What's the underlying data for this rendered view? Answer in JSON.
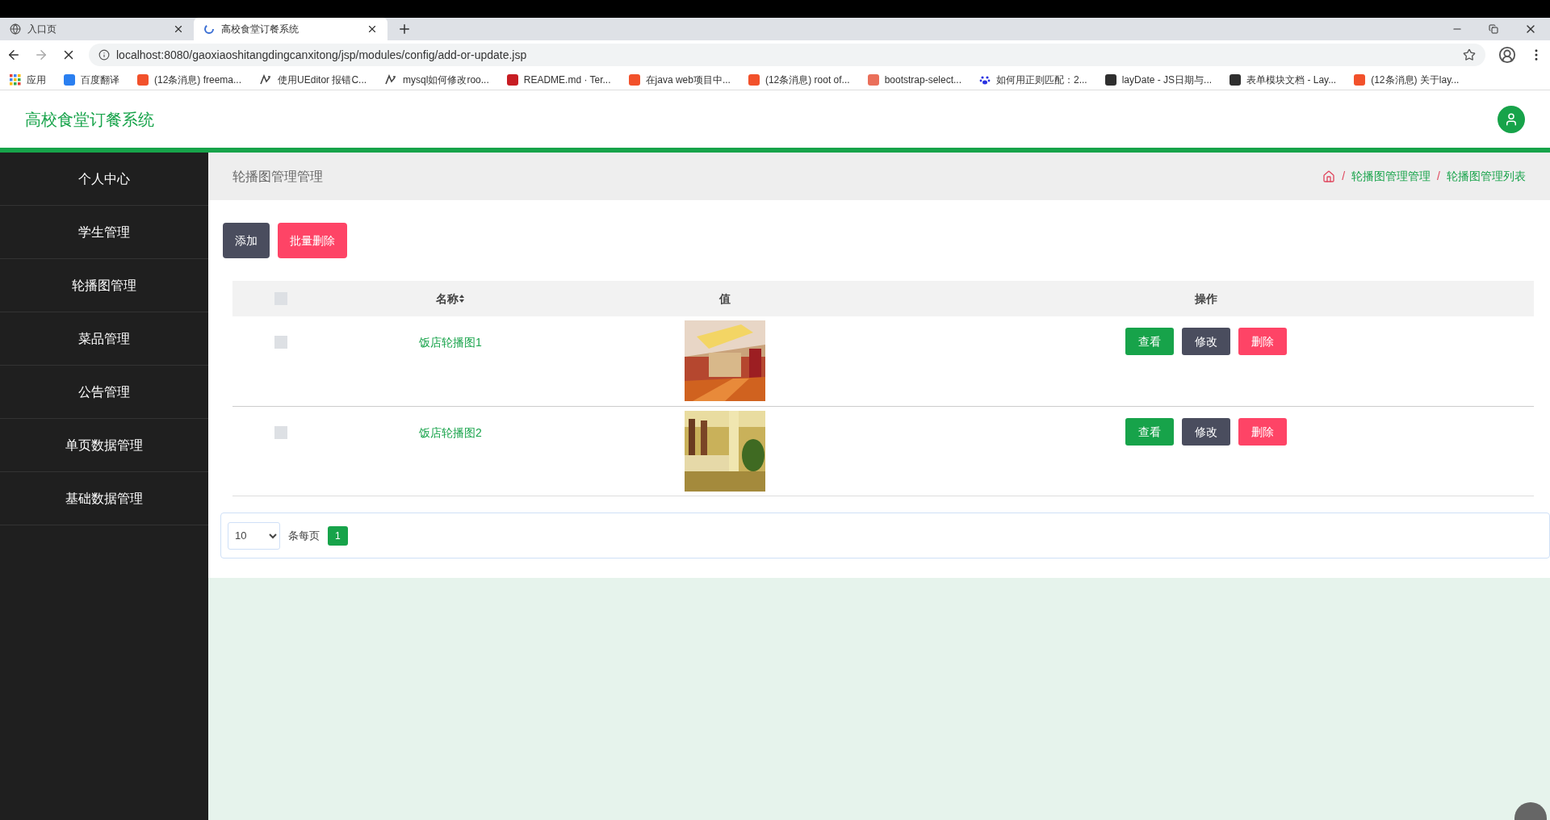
{
  "browser": {
    "tabs": [
      {
        "title": "入口页",
        "selected": false,
        "kind": "globe"
      },
      {
        "title": "高校食堂订餐系统",
        "selected": true,
        "kind": "loading"
      }
    ],
    "url": "localhost:8080/gaoxiaoshitangdingcanxitong/jsp/modules/config/add-or-update.jsp",
    "bookmarks": [
      {
        "label": "应用",
        "kind": "apps"
      },
      {
        "label": "百度翻译",
        "kind": "site",
        "color": "#2a7ff0"
      },
      {
        "label": "(12条消息) freema...",
        "kind": "site",
        "color": "#f2512b"
      },
      {
        "label": "使用UEditor 报错C...",
        "kind": "glyph"
      },
      {
        "label": "mysql如何修改roo...",
        "kind": "glyph"
      },
      {
        "label": "README.md · Ter...",
        "kind": "site",
        "color": "#c71d23"
      },
      {
        "label": "在java web项目中...",
        "kind": "site",
        "color": "#f2512b"
      },
      {
        "label": "(12条消息) root of...",
        "kind": "site",
        "color": "#f2512b"
      },
      {
        "label": "bootstrap-select...",
        "kind": "site",
        "color": "#ea6f5a"
      },
      {
        "label": "如何用正则匹配：2...",
        "kind": "paw"
      },
      {
        "label": "layDate - JS日期与...",
        "kind": "site",
        "color": "#2f2f2f"
      },
      {
        "label": "表单模块文档 - Lay...",
        "kind": "site",
        "color": "#2f2f2f"
      },
      {
        "label": "(12条消息) 关于lay...",
        "kind": "site",
        "color": "#f2512b"
      }
    ]
  },
  "header": {
    "title": "高校食堂订餐系统"
  },
  "sidebar": {
    "items": [
      "个人中心",
      "学生管理",
      "轮播图管理",
      "菜品管理",
      "公告管理",
      "单页数据管理",
      "基础数据管理"
    ]
  },
  "page": {
    "title": "轮播图管理管理",
    "breadcrumb": [
      {
        "separator": "/",
        "label": "轮播图管理管理"
      },
      {
        "separator": "/",
        "label": "轮播图管理列表"
      }
    ]
  },
  "toolbar": [
    {
      "label": "添加",
      "kind": "add"
    },
    {
      "label": "批量删除",
      "kind": "delete"
    }
  ],
  "table": {
    "columns": [
      {
        "label": "名称",
        "sortable": true
      },
      {
        "label": "值",
        "sortable": false
      },
      {
        "label": "操作",
        "sortable": false
      }
    ],
    "select_all": {
      "checked": false
    },
    "rows": [
      {
        "checked": false,
        "name": "饭店轮播图1",
        "actions": [
          {
            "label": "查看",
            "kind": "view"
          },
          {
            "label": "修改",
            "kind": "edit"
          },
          {
            "label": "删除",
            "kind": "delete"
          }
        ]
      },
      {
        "checked": false,
        "name": "饭店轮播图2",
        "actions": [
          {
            "label": "查看",
            "kind": "view"
          },
          {
            "label": "修改",
            "kind": "edit"
          },
          {
            "label": "删除",
            "kind": "delete"
          }
        ]
      }
    ]
  },
  "pagination": {
    "page_size": "10",
    "per_page_label": "条每页",
    "pages": [
      {
        "label": "1",
        "selected": true
      }
    ]
  }
}
